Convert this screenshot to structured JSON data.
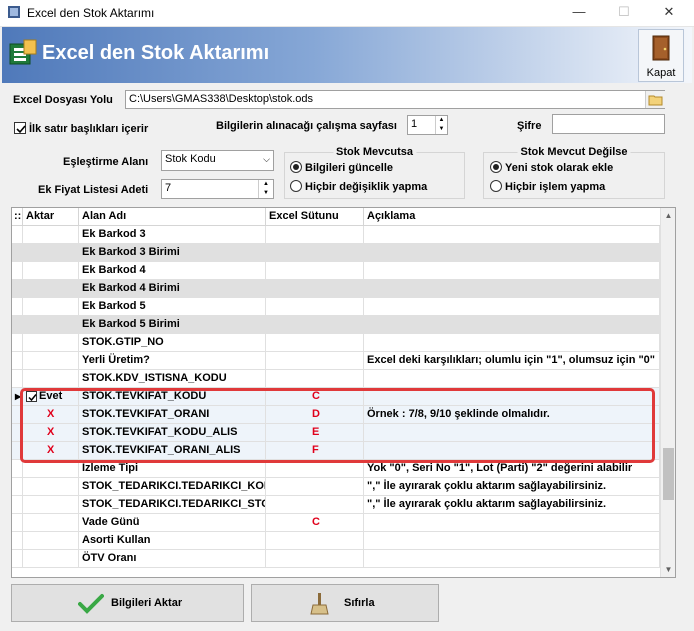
{
  "window": {
    "title": "Excel den Stok Aktarımı",
    "minimize": "—",
    "maximize": "☐",
    "close": "✕"
  },
  "banner": {
    "title": "Excel den Stok Aktarımı",
    "close_label": "Kapat"
  },
  "form": {
    "file_label": "Excel Dosyası Yolu",
    "file_value": "C:\\Users\\GMAS338\\Desktop\\stok.ods",
    "header_checkbox_label": "İlk satır başlıkları içerir",
    "header_checkbox_checked": true,
    "sheet_label": "Bilgilerin alınacağı çalışma sayfası",
    "sheet_value": "1",
    "password_label": "Şifre",
    "password_value": "",
    "match_label": "Eşleştirme Alanı",
    "match_value": "Stok Kodu",
    "price_label": "Ek Fiyat Listesi Adeti",
    "price_value": "7"
  },
  "stock_exists": {
    "title": "Stok Mevcutsa",
    "option1": "Bilgileri güncelle",
    "option2": "Hiçbir değişiklik yapma",
    "selected": 1
  },
  "stock_not_exists": {
    "title": "Stok Mevcut Değilse",
    "option1": "Yeni stok olarak ekle",
    "option2": "Hiçbir işlem yapma",
    "selected": 1
  },
  "grid": {
    "columns": [
      "Aktar",
      "Alan Adı",
      "Excel Sütunu",
      "Açıklama"
    ],
    "rows": [
      {
        "aktar": "",
        "alan": "Ek Barkod 3",
        "sutun": "",
        "aciklama": ""
      },
      {
        "aktar": "",
        "alan": "Ek Barkod 3 Birimi",
        "sutun": "",
        "aciklama": ""
      },
      {
        "aktar": "",
        "alan": "Ek Barkod 4",
        "sutun": "",
        "aciklama": ""
      },
      {
        "aktar": "",
        "alan": "Ek Barkod 4 Birimi",
        "sutun": "",
        "aciklama": ""
      },
      {
        "aktar": "",
        "alan": "Ek Barkod 5",
        "sutun": "",
        "aciklama": ""
      },
      {
        "aktar": "",
        "alan": "Ek Barkod 5 Birimi",
        "sutun": "",
        "aciklama": ""
      },
      {
        "aktar": "",
        "alan": "STOK.GTIP_NO",
        "sutun": "",
        "aciklama": ""
      },
      {
        "aktar": "",
        "alan": "Yerli Üretim?",
        "sutun": "",
        "aciklama": "Excel deki karşılıkları; olumlu için \"1\", olumsuz için \"0\""
      },
      {
        "aktar": "",
        "alan": "STOK.KDV_ISTISNA_KODU",
        "sutun": "",
        "aciklama": ""
      },
      {
        "aktar": "Evet",
        "alan": "STOK.TEVKIFAT_KODU",
        "sutun": "C",
        "aciklama": ""
      },
      {
        "aktar": "X",
        "alan": "STOK.TEVKIFAT_ORANI",
        "sutun": "D",
        "aciklama": "Örnek : 7/8, 9/10 şeklinde olmalıdır."
      },
      {
        "aktar": "X",
        "alan": "STOK.TEVKIFAT_KODU_ALIS",
        "sutun": "E",
        "aciklama": ""
      },
      {
        "aktar": "X",
        "alan": "STOK.TEVKIFAT_ORANI_ALIS",
        "sutun": "F",
        "aciklama": ""
      },
      {
        "aktar": "",
        "alan": "İzleme Tipi",
        "sutun": "",
        "aciklama": "Yok \"0\", Seri No \"1\", Lot (Parti) \"2\" değerini alabilir"
      },
      {
        "aktar": "",
        "alan": "STOK_TEDARIKCI.TEDARIKCI_KODU",
        "sutun": "",
        "aciklama": "\",\" İle ayırarak çoklu aktarım sağlayabilirsiniz."
      },
      {
        "aktar": "",
        "alan": "STOK_TEDARIKCI.TEDARIKCI_STOK_KODU",
        "sutun": "",
        "aciklama": "\",\" İle ayırarak çoklu aktarım sağlayabilirsiniz."
      },
      {
        "aktar": "",
        "alan": "Vade Günü",
        "sutun": "C",
        "aciklama": ""
      },
      {
        "aktar": "",
        "alan": "Asorti Kullan",
        "sutun": "",
        "aciklama": ""
      },
      {
        "aktar": "",
        "alan": "ÖTV Oranı",
        "sutun": "",
        "aciklama": ""
      }
    ]
  },
  "buttons": {
    "import": "Bilgileri Aktar",
    "reset": "Sıfırla"
  },
  "colors": {
    "banner_start": "#4f79ba",
    "banner_end": "#f3f6fb",
    "highlight_border": "#e0393a",
    "red_text": "#e0001b",
    "gray_row": "#e0e0e0"
  }
}
